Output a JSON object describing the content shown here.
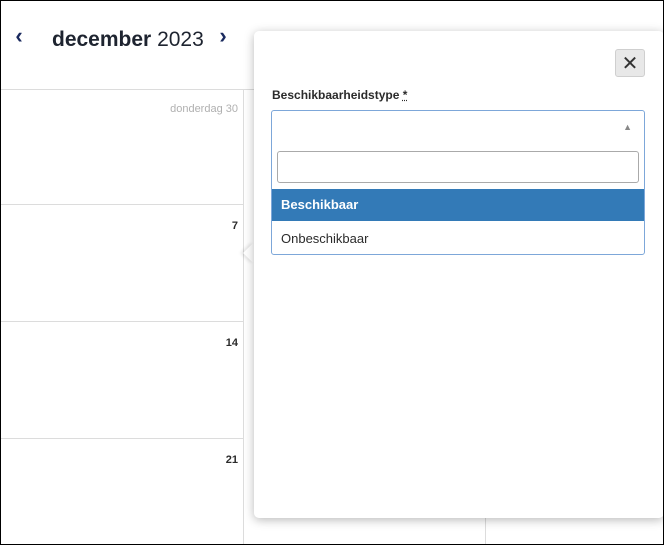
{
  "calendar": {
    "month": "december",
    "year": "2023",
    "prev_icon": "chevron-left-icon",
    "next_icon": "chevron-right-icon",
    "days": [
      {
        "label": "donderdag 30",
        "muted": true
      },
      {
        "label": "7",
        "muted": false
      },
      {
        "label": "14",
        "muted": false
      },
      {
        "label": "21",
        "muted": false
      }
    ]
  },
  "popover": {
    "close_icon": "close-icon",
    "field_label": "Beschikbaarheidstype",
    "required_marker": "*",
    "search_placeholder": "",
    "options": [
      {
        "label": "Beschikbaar",
        "selected": true
      },
      {
        "label": "Onbeschikbaar",
        "selected": false
      }
    ]
  },
  "colors": {
    "accent": "#337ab7",
    "focus_border": "#7da7d9",
    "nav_arrow": "#1a2a5e"
  }
}
